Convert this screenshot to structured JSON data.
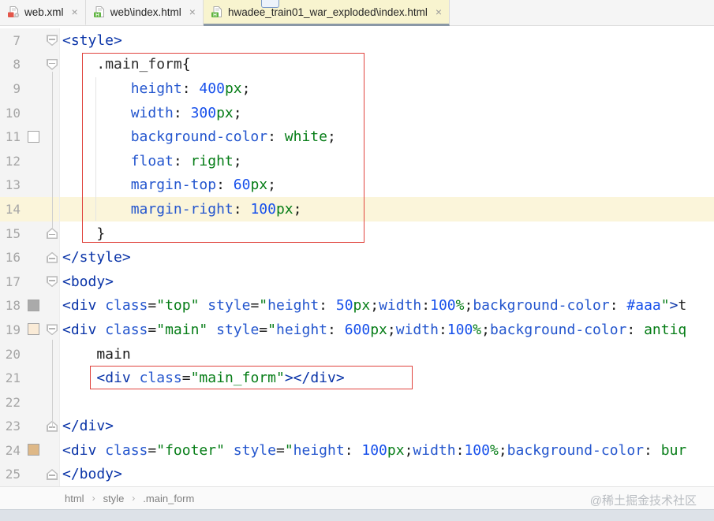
{
  "tabs": {
    "items": [
      {
        "label": "web.xml",
        "icon": "webxml-file-icon",
        "close": "×",
        "active": false
      },
      {
        "label": "web\\index.html",
        "icon": "html-file-icon",
        "close": "×",
        "active": false
      },
      {
        "label": "hwadee_train01_war_exploded\\index.html",
        "icon": "html-file-icon",
        "close": "×",
        "active": true
      }
    ],
    "active_bg": "#F8F4CF",
    "active_underline": "#8A98A6"
  },
  "editor": {
    "annotation_color": "#E0443E",
    "current_line_bg": "#FBF5DA",
    "swatch_colors": {
      "white": "#FFFFFF",
      "gray": "#AAAAAA",
      "antiquewhite": "#FAEBD7",
      "burlywood": "#DEB887"
    },
    "lines": [
      {
        "num": "7",
        "fold": "start",
        "swatch": null,
        "highlight": false,
        "tokens": [
          [
            "<style>",
            "tag"
          ]
        ]
      },
      {
        "num": "8",
        "fold": "start",
        "swatch": null,
        "highlight": false,
        "tokens": [
          [
            "    ",
            "pl"
          ],
          [
            ".main_form",
            "sel"
          ],
          [
            "{",
            "pl"
          ]
        ]
      },
      {
        "num": "9",
        "fold": null,
        "swatch": null,
        "highlight": false,
        "tokens": [
          [
            "        ",
            "pl"
          ],
          [
            "height",
            "prop"
          ],
          [
            ": ",
            "pl"
          ],
          [
            "400",
            "num"
          ],
          [
            "px",
            "unit"
          ],
          [
            ";",
            "pl"
          ]
        ]
      },
      {
        "num": "10",
        "fold": null,
        "swatch": null,
        "highlight": false,
        "tokens": [
          [
            "        ",
            "pl"
          ],
          [
            "width",
            "prop"
          ],
          [
            ": ",
            "pl"
          ],
          [
            "300",
            "num"
          ],
          [
            "px",
            "unit"
          ],
          [
            ";",
            "pl"
          ]
        ]
      },
      {
        "num": "11",
        "fold": null,
        "swatch": "#FFFFFF",
        "highlight": false,
        "tokens": [
          [
            "        ",
            "pl"
          ],
          [
            "background-color",
            "prop"
          ],
          [
            ": ",
            "pl"
          ],
          [
            "white",
            "unit"
          ],
          [
            ";",
            "pl"
          ]
        ]
      },
      {
        "num": "12",
        "fold": null,
        "swatch": null,
        "highlight": false,
        "tokens": [
          [
            "        ",
            "pl"
          ],
          [
            "float",
            "prop"
          ],
          [
            ": ",
            "pl"
          ],
          [
            "right",
            "unit"
          ],
          [
            ";",
            "pl"
          ]
        ]
      },
      {
        "num": "13",
        "fold": null,
        "swatch": null,
        "highlight": false,
        "tokens": [
          [
            "        ",
            "pl"
          ],
          [
            "margin-top",
            "prop"
          ],
          [
            ": ",
            "pl"
          ],
          [
            "60",
            "num"
          ],
          [
            "px",
            "unit"
          ],
          [
            ";",
            "pl"
          ]
        ]
      },
      {
        "num": "14",
        "fold": null,
        "swatch": null,
        "highlight": true,
        "tokens": [
          [
            "        ",
            "pl"
          ],
          [
            "margin-right",
            "prop"
          ],
          [
            ": ",
            "pl"
          ],
          [
            "100",
            "num"
          ],
          [
            "px",
            "unit"
          ],
          [
            ";",
            "pl"
          ]
        ]
      },
      {
        "num": "15",
        "fold": "end",
        "swatch": null,
        "highlight": false,
        "tokens": [
          [
            "    }",
            "pl"
          ]
        ]
      },
      {
        "num": "16",
        "fold": "end",
        "swatch": null,
        "highlight": false,
        "tokens": [
          [
            "</style>",
            "tag"
          ]
        ]
      },
      {
        "num": "17",
        "fold": "start",
        "swatch": null,
        "highlight": false,
        "tokens": [
          [
            "<body>",
            "tag"
          ]
        ]
      },
      {
        "num": "18",
        "fold": null,
        "swatch": "#AAAAAA",
        "highlight": false,
        "tokens": [
          [
            "<div",
            "tag"
          ],
          [
            " ",
            "pl"
          ],
          [
            "class",
            "attr"
          ],
          [
            "=",
            "pl"
          ],
          [
            "\"top\"",
            "str"
          ],
          [
            " ",
            "pl"
          ],
          [
            "style",
            "attr"
          ],
          [
            "=",
            "pl"
          ],
          [
            "\"",
            "str"
          ],
          [
            "height",
            "prop"
          ],
          [
            ": ",
            "pl"
          ],
          [
            "50",
            "num"
          ],
          [
            "px",
            "unit"
          ],
          [
            ";",
            "pl"
          ],
          [
            "width",
            "prop"
          ],
          [
            ":",
            "pl"
          ],
          [
            "100",
            "num"
          ],
          [
            "%",
            "unit"
          ],
          [
            ";",
            "pl"
          ],
          [
            "background-color",
            "prop"
          ],
          [
            ": ",
            "pl"
          ],
          [
            "#aaa",
            "num"
          ],
          [
            "\"",
            "str"
          ],
          [
            ">",
            "tag"
          ],
          [
            "t",
            "txt"
          ]
        ]
      },
      {
        "num": "19",
        "fold": "start",
        "swatch": "#FAEBD7",
        "highlight": false,
        "tokens": [
          [
            "<div",
            "tag"
          ],
          [
            " ",
            "pl"
          ],
          [
            "class",
            "attr"
          ],
          [
            "=",
            "pl"
          ],
          [
            "\"main\"",
            "str"
          ],
          [
            " ",
            "pl"
          ],
          [
            "style",
            "attr"
          ],
          [
            "=",
            "pl"
          ],
          [
            "\"",
            "str"
          ],
          [
            "height",
            "prop"
          ],
          [
            ": ",
            "pl"
          ],
          [
            "600",
            "num"
          ],
          [
            "px",
            "unit"
          ],
          [
            ";",
            "pl"
          ],
          [
            "width",
            "prop"
          ],
          [
            ":",
            "pl"
          ],
          [
            "100",
            "num"
          ],
          [
            "%",
            "unit"
          ],
          [
            ";",
            "pl"
          ],
          [
            "background-color",
            "prop"
          ],
          [
            ": ",
            "pl"
          ],
          [
            "antiq",
            "unit"
          ]
        ]
      },
      {
        "num": "20",
        "fold": null,
        "swatch": null,
        "highlight": false,
        "tokens": [
          [
            "    main",
            "txt"
          ]
        ]
      },
      {
        "num": "21",
        "fold": null,
        "swatch": null,
        "highlight": false,
        "tokens": [
          [
            "    ",
            "pl"
          ],
          [
            "<div",
            "tag"
          ],
          [
            " ",
            "pl"
          ],
          [
            "class",
            "attr"
          ],
          [
            "=",
            "pl"
          ],
          [
            "\"main_form\"",
            "str"
          ],
          [
            ">",
            "tag"
          ],
          [
            "</div>",
            "tag"
          ]
        ]
      },
      {
        "num": "22",
        "fold": null,
        "swatch": null,
        "highlight": false,
        "tokens": []
      },
      {
        "num": "23",
        "fold": "end",
        "swatch": null,
        "highlight": false,
        "tokens": [
          [
            "</div>",
            "tag"
          ]
        ]
      },
      {
        "num": "24",
        "fold": null,
        "swatch": "#DEB887",
        "highlight": false,
        "tokens": [
          [
            "<div",
            "tag"
          ],
          [
            " ",
            "pl"
          ],
          [
            "class",
            "attr"
          ],
          [
            "=",
            "pl"
          ],
          [
            "\"footer\"",
            "str"
          ],
          [
            " ",
            "pl"
          ],
          [
            "style",
            "attr"
          ],
          [
            "=",
            "pl"
          ],
          [
            "\"",
            "str"
          ],
          [
            "height",
            "prop"
          ],
          [
            ": ",
            "pl"
          ],
          [
            "100",
            "num"
          ],
          [
            "px",
            "unit"
          ],
          [
            ";",
            "pl"
          ],
          [
            "width",
            "prop"
          ],
          [
            ":",
            "pl"
          ],
          [
            "100",
            "num"
          ],
          [
            "%",
            "unit"
          ],
          [
            ";",
            "pl"
          ],
          [
            "background-color",
            "prop"
          ],
          [
            ": ",
            "pl"
          ],
          [
            "bur",
            "unit"
          ]
        ]
      },
      {
        "num": "25",
        "fold": "end",
        "swatch": null,
        "highlight": false,
        "tokens": [
          [
            "</body>",
            "tag"
          ]
        ]
      }
    ]
  },
  "breadcrumbs": {
    "items": [
      "html",
      "style",
      ".main_form"
    ],
    "separator": "›"
  },
  "watermark": "@稀土掘金技术社区"
}
